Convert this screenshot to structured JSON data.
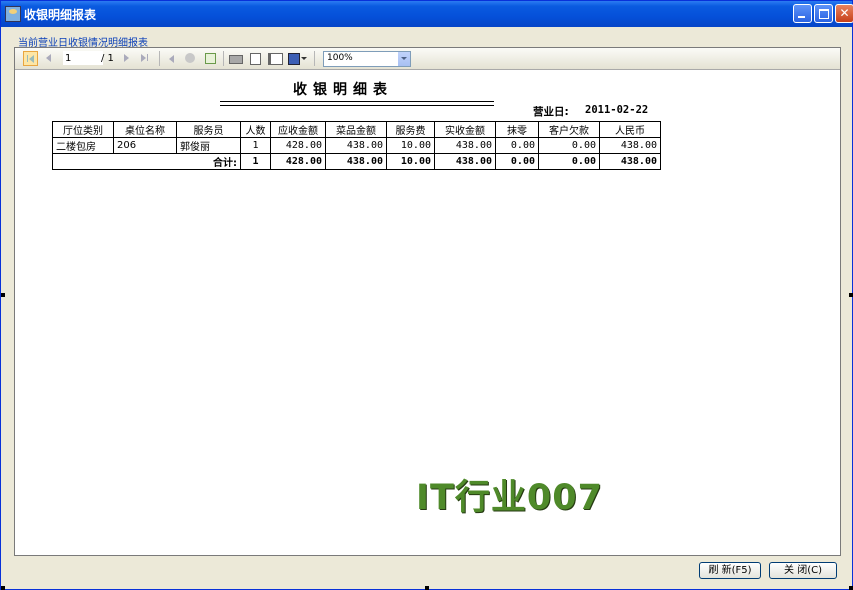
{
  "window": {
    "title": "收银明细报表"
  },
  "subtitle": "当前营业日收银情况明细报表",
  "toolbar": {
    "page_value": "1",
    "page_total": "/ 1",
    "zoom": "100%"
  },
  "report": {
    "title": "收银明细表",
    "date_label": "营业日:",
    "date_value": "2011-02-22",
    "columns": [
      "厅位类别",
      "桌位名称",
      "服务员",
      "人数",
      "应收金额",
      "菜品金额",
      "服务费",
      "实收金额",
      "抹零",
      "客户欠款",
      "人民币"
    ],
    "rows": [
      [
        "二楼包房",
        "206",
        "郭俊丽",
        "1",
        "428.00",
        "438.00",
        "10.00",
        "438.00",
        "0.00",
        "0.00",
        "438.00"
      ]
    ],
    "total": {
      "label": "合计:",
      "people": "1",
      "receivable": "428.00",
      "dishes": "438.00",
      "service": "10.00",
      "paid": "438.00",
      "rounding": "0.00",
      "debt": "0.00",
      "rmb": "438.00"
    }
  },
  "watermark": "IT行业007",
  "buttons": {
    "refresh": "刷 新(F5)",
    "close": "关 闭(C)"
  },
  "colors": {
    "titlebar": "#0550d9",
    "subtitle_text": "#0a3fb8",
    "watermark": "#4f8a2a"
  }
}
